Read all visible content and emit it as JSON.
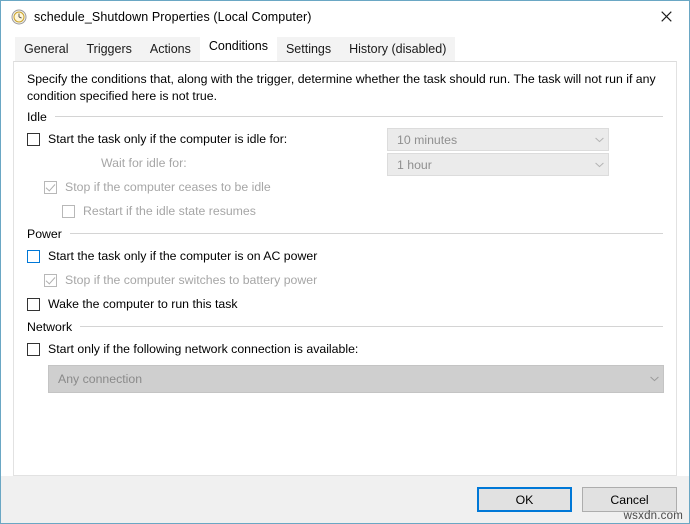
{
  "window": {
    "title": "schedule_Shutdown Properties (Local Computer)",
    "icon": "clock-scheduler-icon",
    "close_label": "Close",
    "border_color": "#6aa7c4",
    "accent_color": "#0078d7"
  },
  "tabs": [
    {
      "label": "General",
      "selected": false
    },
    {
      "label": "Triggers",
      "selected": false
    },
    {
      "label": "Actions",
      "selected": false
    },
    {
      "label": "Conditions",
      "selected": true
    },
    {
      "label": "Settings",
      "selected": false
    },
    {
      "label": "History (disabled)",
      "selected": false
    }
  ],
  "main": {
    "description": "Specify the conditions that, along with the trigger, determine whether the task should run.  The task will not run  if any condition specified here is not true.",
    "groups": {
      "idle": {
        "label": "Idle",
        "start_if_idle": {
          "label": "Start the task only if the computer is idle for:",
          "checked": false,
          "disabled": false
        },
        "idle_duration": {
          "value": "10 minutes",
          "disabled": true
        },
        "wait_for_idle_label": "Wait for idle for:",
        "wait_duration": {
          "value": "1 hour",
          "disabled": true
        },
        "stop_if_ceases_idle": {
          "label": "Stop if the computer ceases to be idle",
          "checked": true,
          "disabled": true
        },
        "restart_if_idle_resumes": {
          "label": "Restart if the idle state resumes",
          "checked": false,
          "disabled": true
        }
      },
      "power": {
        "label": "Power",
        "start_if_ac": {
          "label": "Start the task only if the computer is on AC power",
          "checked": false,
          "disabled": false,
          "focused": true
        },
        "stop_if_battery": {
          "label": "Stop if the computer switches to battery power",
          "checked": true,
          "disabled": true
        },
        "wake_computer": {
          "label": "Wake the computer to run this task",
          "checked": false,
          "disabled": false
        }
      },
      "network": {
        "label": "Network",
        "start_if_network": {
          "label": "Start only if the following network connection is available:",
          "checked": false,
          "disabled": false
        },
        "connection": {
          "value": "Any connection",
          "disabled": true
        }
      }
    }
  },
  "footer": {
    "ok_label": "OK",
    "cancel_label": "Cancel",
    "watermark": "wsxdn.com"
  }
}
